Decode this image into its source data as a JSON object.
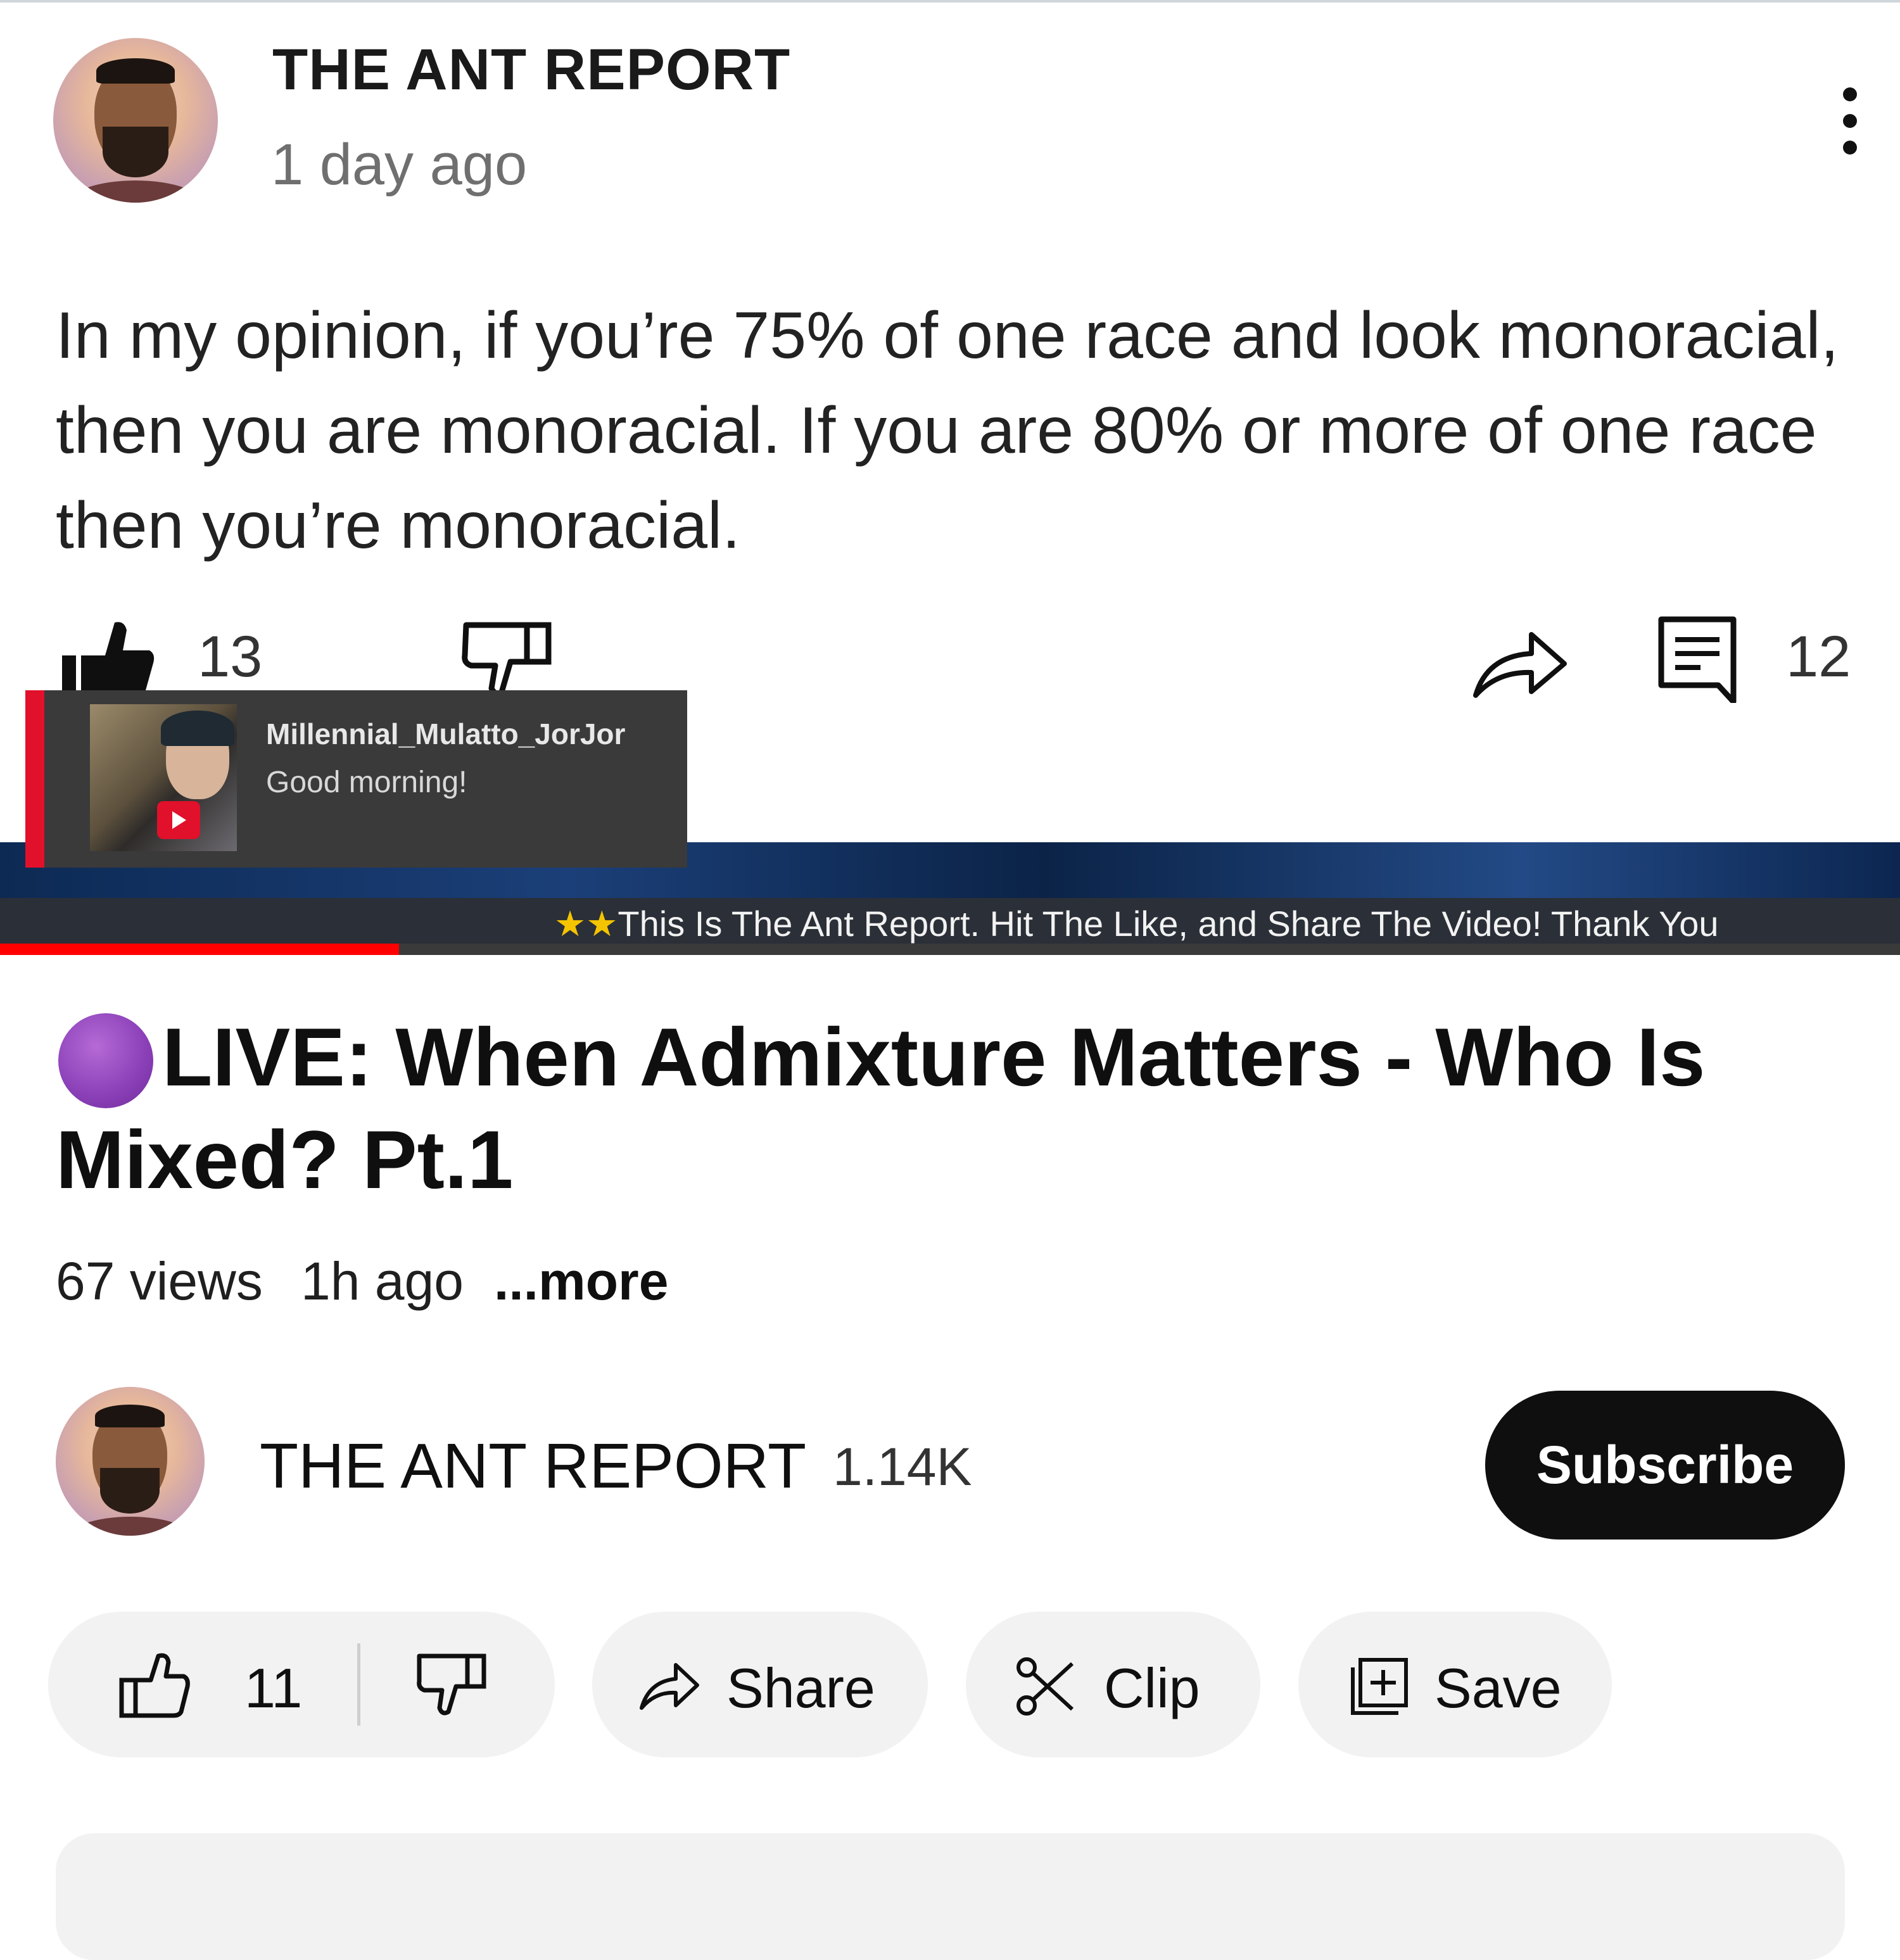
{
  "post": {
    "channel": "THE ANT REPORT",
    "time": "1 day ago",
    "body": "In my opinion, if you’re 75% of one race and look monoracial, then you are monoracial. If you are 80% or more of one race then you’re monoracial.",
    "likes": "13",
    "comments": "12"
  },
  "chat": {
    "username": "Millennial_Mulatto_JorJor",
    "message": "Good morning!"
  },
  "ticker": {
    "stars": "★★",
    "text": "This Is The Ant Report. Hit The Like, and Share The Video! Thank You"
  },
  "playback": {
    "progress_fraction": 0.21
  },
  "video": {
    "title": "LIVE: When Admixture Matters - Who Is Mixed? Pt.1",
    "views": "67 views",
    "age": "1h ago",
    "more": "...more"
  },
  "channel": {
    "name": "THE ANT REPORT",
    "subscribers": "1.14K",
    "subscribe_label": "Subscribe"
  },
  "actions": {
    "likes": "11",
    "share_label": "Share",
    "clip_label": "Clip",
    "save_label": "Save"
  },
  "colors": {
    "accent_red": "#ff0000",
    "live_purple": "#8a3fb7",
    "chip_bg": "#f2f2f2"
  }
}
